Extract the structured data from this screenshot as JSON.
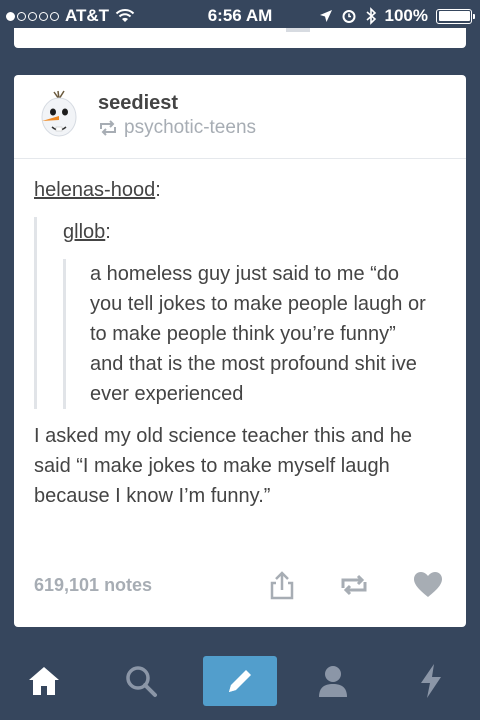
{
  "status_bar": {
    "carrier": "AT&T",
    "signal_bars_filled": 1,
    "signal_bars_total": 5,
    "time": "6:56 AM",
    "battery": "100%"
  },
  "post": {
    "blog_name": "seediest",
    "reblogged_from": "psychotic-teens",
    "thread": [
      {
        "user": "helenas-hood",
        "suffix": ":"
      },
      {
        "user": "gllob",
        "suffix": ":"
      }
    ],
    "original_text": "a homeless guy just said to me “do you tell jokes to make people laugh or to make people think you’re funny” and that is the most profound shit ive ever experienced",
    "reply_text": "I asked my old science teacher this and he said “I make jokes to make myself laugh because I know I’m funny.”",
    "notes": "619,101 notes"
  },
  "colors": {
    "background": "#36465d",
    "accent": "#529ecc",
    "muted": "#a7adb4",
    "text": "#444444"
  },
  "tab_bar": {
    "items": [
      "home-icon",
      "search-icon",
      "compose-icon",
      "account-icon",
      "activity-icon"
    ]
  }
}
